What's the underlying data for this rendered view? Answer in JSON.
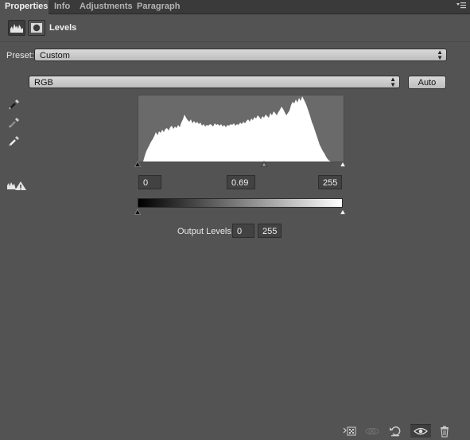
{
  "tabs": [
    {
      "label": "Properties",
      "active": true
    },
    {
      "label": "Info",
      "active": false
    },
    {
      "label": "Adjustments",
      "active": false
    },
    {
      "label": "Paragraph",
      "active": false
    }
  ],
  "panel": {
    "title": "Levels"
  },
  "preset": {
    "label": "Preset:",
    "value": "Custom"
  },
  "channel": {
    "value": "RGB",
    "auto_label": "Auto"
  },
  "input_levels": {
    "black": "0",
    "gamma": "0.69",
    "white": "255"
  },
  "output_levels": {
    "label": "Output Levels:",
    "black": "0",
    "white": "255"
  },
  "icons": [
    "levels-adjustment-icon",
    "layer-mask-icon",
    "black-point-eyedropper-icon",
    "gray-point-eyedropper-icon",
    "white-point-eyedropper-icon",
    "clipping-warning-icon",
    "clip-to-layer-icon",
    "view-previous-state-icon",
    "reset-icon",
    "visibility-eye-icon",
    "trash-icon",
    "panel-menu-icon"
  ],
  "colors": {
    "panel_bg": "#535353",
    "tab_bar": "#3a3a3a",
    "histogram_bg": "#6a6a6a"
  }
}
